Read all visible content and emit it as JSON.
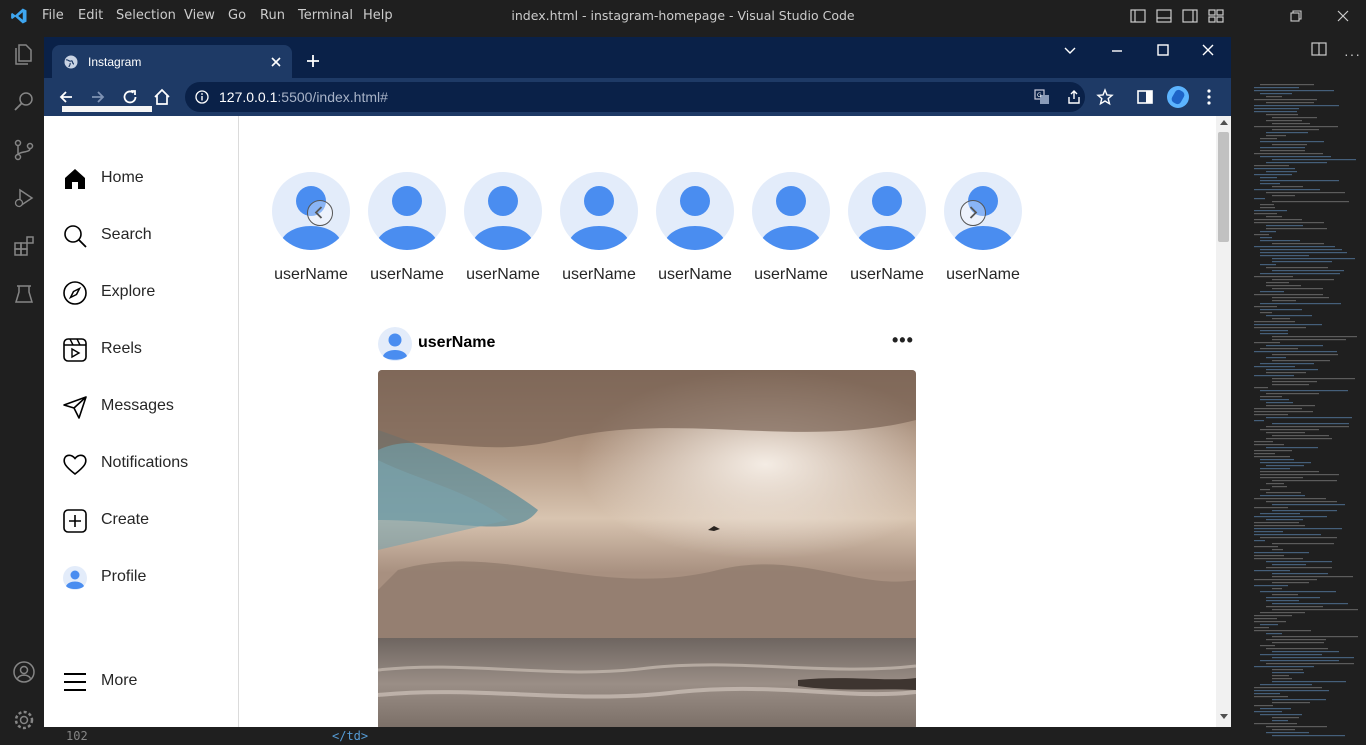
{
  "vscode": {
    "menu": [
      "File",
      "Edit",
      "Selection",
      "View",
      "Go",
      "Run",
      "Terminal",
      "Help"
    ],
    "title": "index.html - instagram-homepage - Visual Studio Code",
    "line_number": "102",
    "code_fragment": "</td>"
  },
  "browser": {
    "tab_title": "Instagram",
    "url_host": "127.0.0.1",
    "url_rest": ":5500/index.html#"
  },
  "sidebar": {
    "items": [
      {
        "label": "Home",
        "icon": "home-icon"
      },
      {
        "label": "Search",
        "icon": "search-icon"
      },
      {
        "label": "Explore",
        "icon": "compass-icon"
      },
      {
        "label": "Reels",
        "icon": "reels-icon"
      },
      {
        "label": "Messages",
        "icon": "send-icon"
      },
      {
        "label": "Notifications",
        "icon": "heart-icon"
      },
      {
        "label": "Create",
        "icon": "plus-square-icon"
      },
      {
        "label": "Profile",
        "icon": "avatar-icon"
      }
    ],
    "more_label": "More"
  },
  "stories": [
    {
      "name": "userName"
    },
    {
      "name": "userName"
    },
    {
      "name": "userName"
    },
    {
      "name": "userName"
    },
    {
      "name": "userName"
    },
    {
      "name": "userName"
    },
    {
      "name": "userName"
    },
    {
      "name": "userName"
    }
  ],
  "post": {
    "username": "userName",
    "more": "•••"
  },
  "colors": {
    "avatar_blue": "#4a8df0",
    "avatar_bg": "#e3ecfa",
    "browser_dark": "#0a2148",
    "browser_toolbar": "#1e3a66",
    "vscode_bg": "#1f1f1f"
  }
}
